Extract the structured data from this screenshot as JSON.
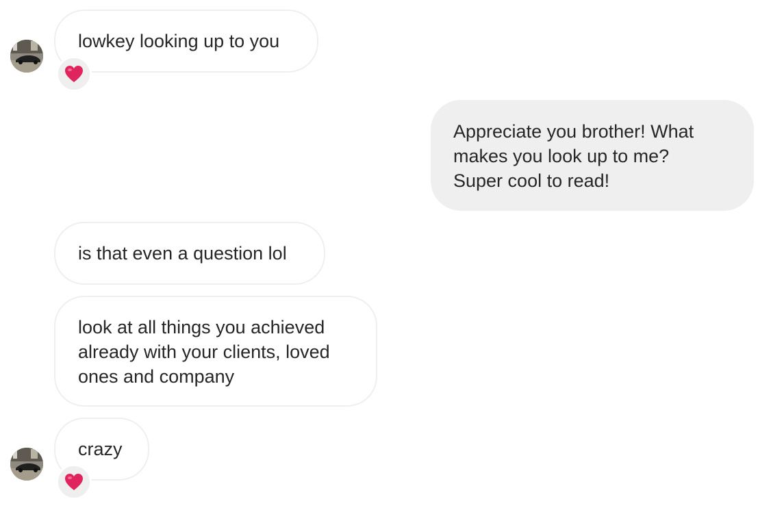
{
  "conversation": {
    "messages": [
      {
        "direction": "incoming",
        "text": "lowkey looking up to you",
        "reaction": "heart-icon"
      },
      {
        "direction": "outgoing",
        "text": "Appreciate you brother! What\nmakes you look up to me?\nSuper cool to read!"
      },
      {
        "direction": "incoming",
        "text": "is that even a question lol"
      },
      {
        "direction": "incoming",
        "text": "look at all things you achieved\nalready with your clients, loved\nones and company"
      },
      {
        "direction": "incoming",
        "text": "crazy",
        "reaction": "heart-icon"
      }
    ]
  },
  "colors": {
    "incoming_bubble_border": "#efefef",
    "outgoing_bubble_bg": "#efefef",
    "text": "#262626",
    "reaction_heart": "#e0245e"
  }
}
